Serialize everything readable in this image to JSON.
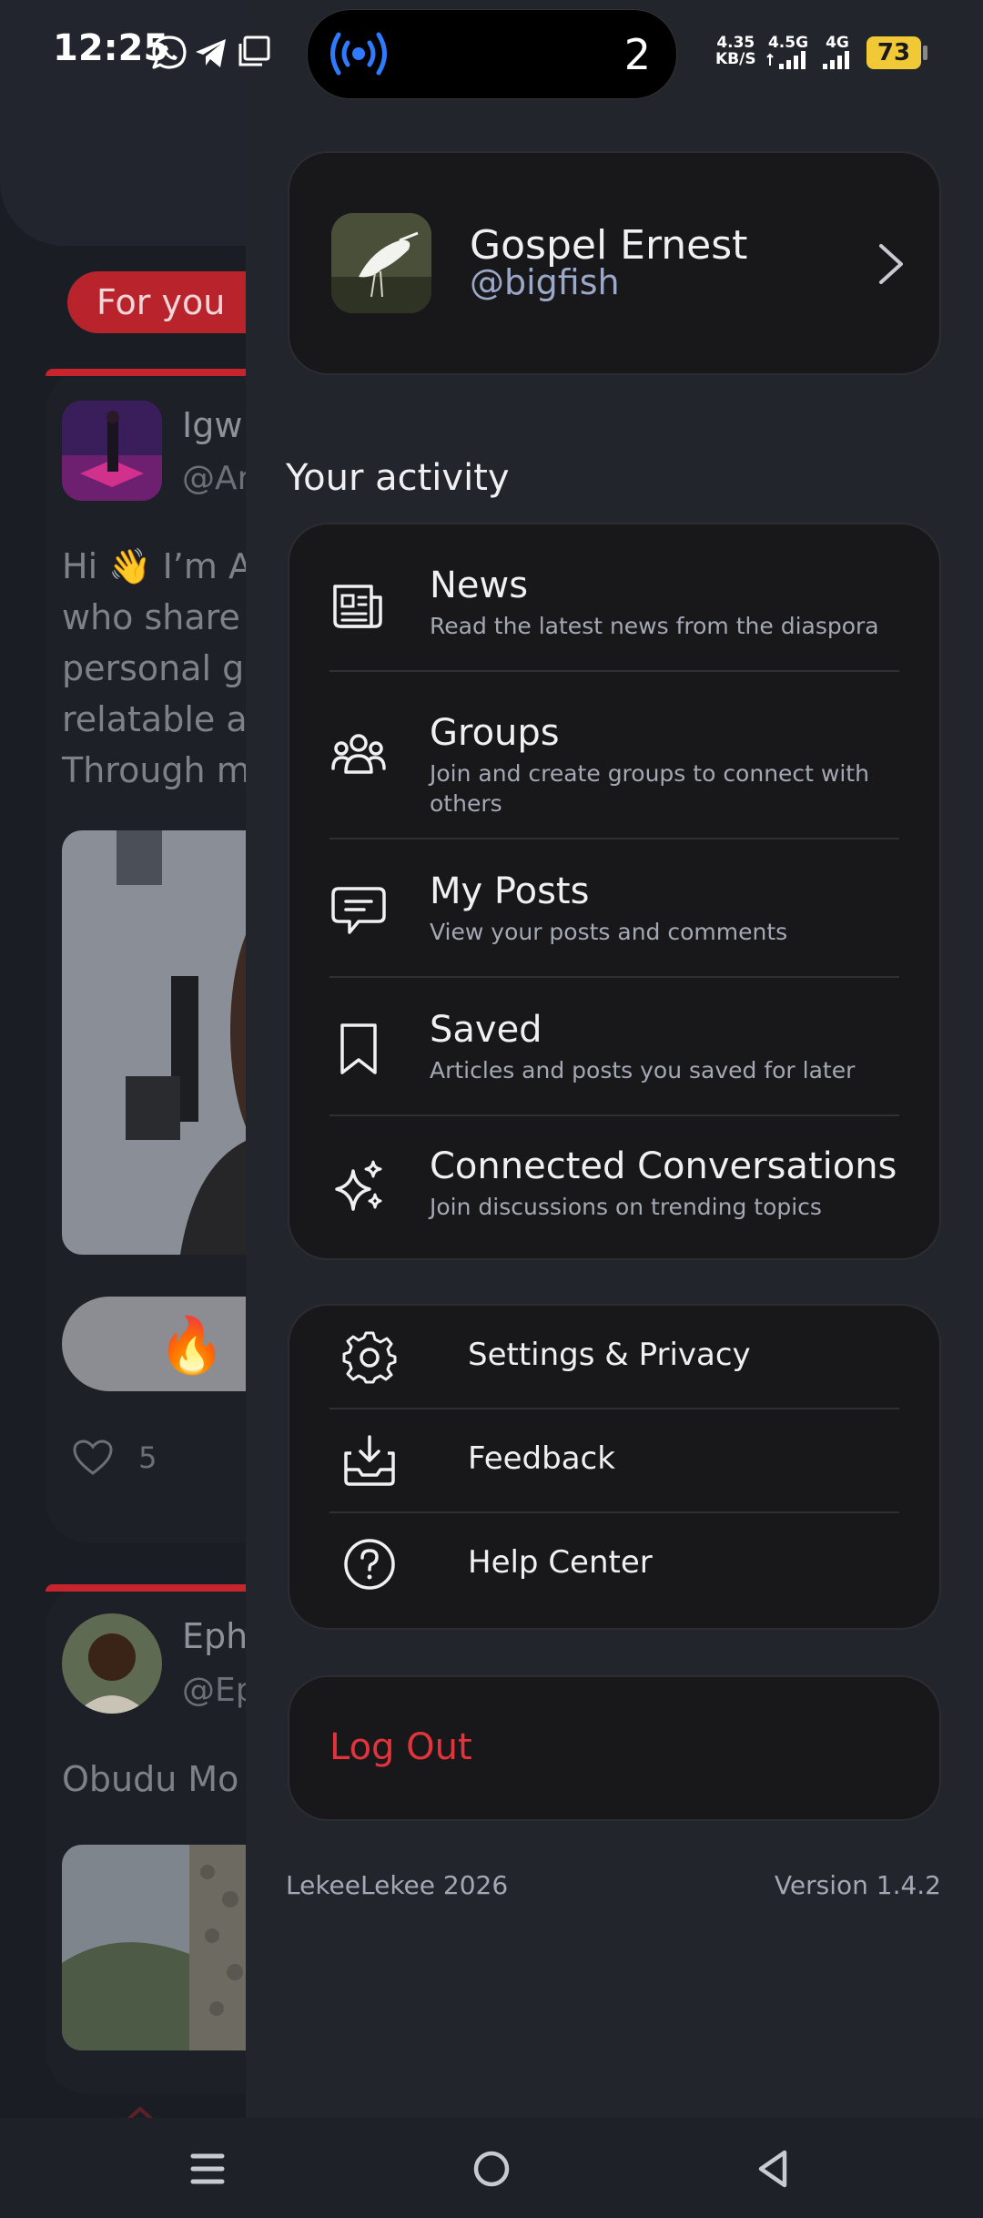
{
  "status_bar": {
    "time": "12:25",
    "island_count": "2",
    "net_speed_value": "4.35",
    "net_speed_unit": "KB/S",
    "sim1_label": "4.5G",
    "sim2_label": "4G",
    "battery": "73"
  },
  "background_feed": {
    "tab_label": "For you",
    "post1": {
      "name": "Igw",
      "handle": "@Ar",
      "text_lines": [
        "Hi 👋 I’m A",
        "who share",
        "personal g",
        "relatable a",
        "Through m"
      ],
      "reaction_emoji": "🔥",
      "like_count": "5"
    },
    "post2": {
      "name": "Eph",
      "handle": "@Ep",
      "text": "Obudu Mo"
    }
  },
  "drawer": {
    "profile": {
      "name": "Gospel Ernest",
      "handle": "@bigfish"
    },
    "activity_title": "Your activity",
    "activity_items": [
      {
        "icon": "newspaper-icon",
        "title": "News",
        "subtitle": "Read the latest news from the diaspora"
      },
      {
        "icon": "groups-icon",
        "title": "Groups",
        "subtitle": "Join and create groups to connect with others"
      },
      {
        "icon": "comment-icon",
        "title": "My Posts",
        "subtitle": "View your posts and comments"
      },
      {
        "icon": "bookmark-icon",
        "title": "Saved",
        "subtitle": "Articles and posts you saved for later"
      },
      {
        "icon": "sparkles-icon",
        "title": "Connected Conversations",
        "subtitle": "Join discussions on trending topics"
      }
    ],
    "settings_items": [
      {
        "icon": "gear-icon",
        "label": "Settings & Privacy"
      },
      {
        "icon": "inbox-download-icon",
        "label": "Feedback"
      },
      {
        "icon": "help-circle-icon",
        "label": "Help Center"
      }
    ],
    "logout_label": "Log Out",
    "footer": {
      "brand": "LekeeLekee 2026",
      "version": "Version 1.4.2"
    }
  },
  "colors": {
    "accent_red": "#e2343a",
    "drawer_bg": "#23252c",
    "card_bg": "#18181b",
    "battery": "#f1c936",
    "island_icon": "#2f7bff"
  }
}
